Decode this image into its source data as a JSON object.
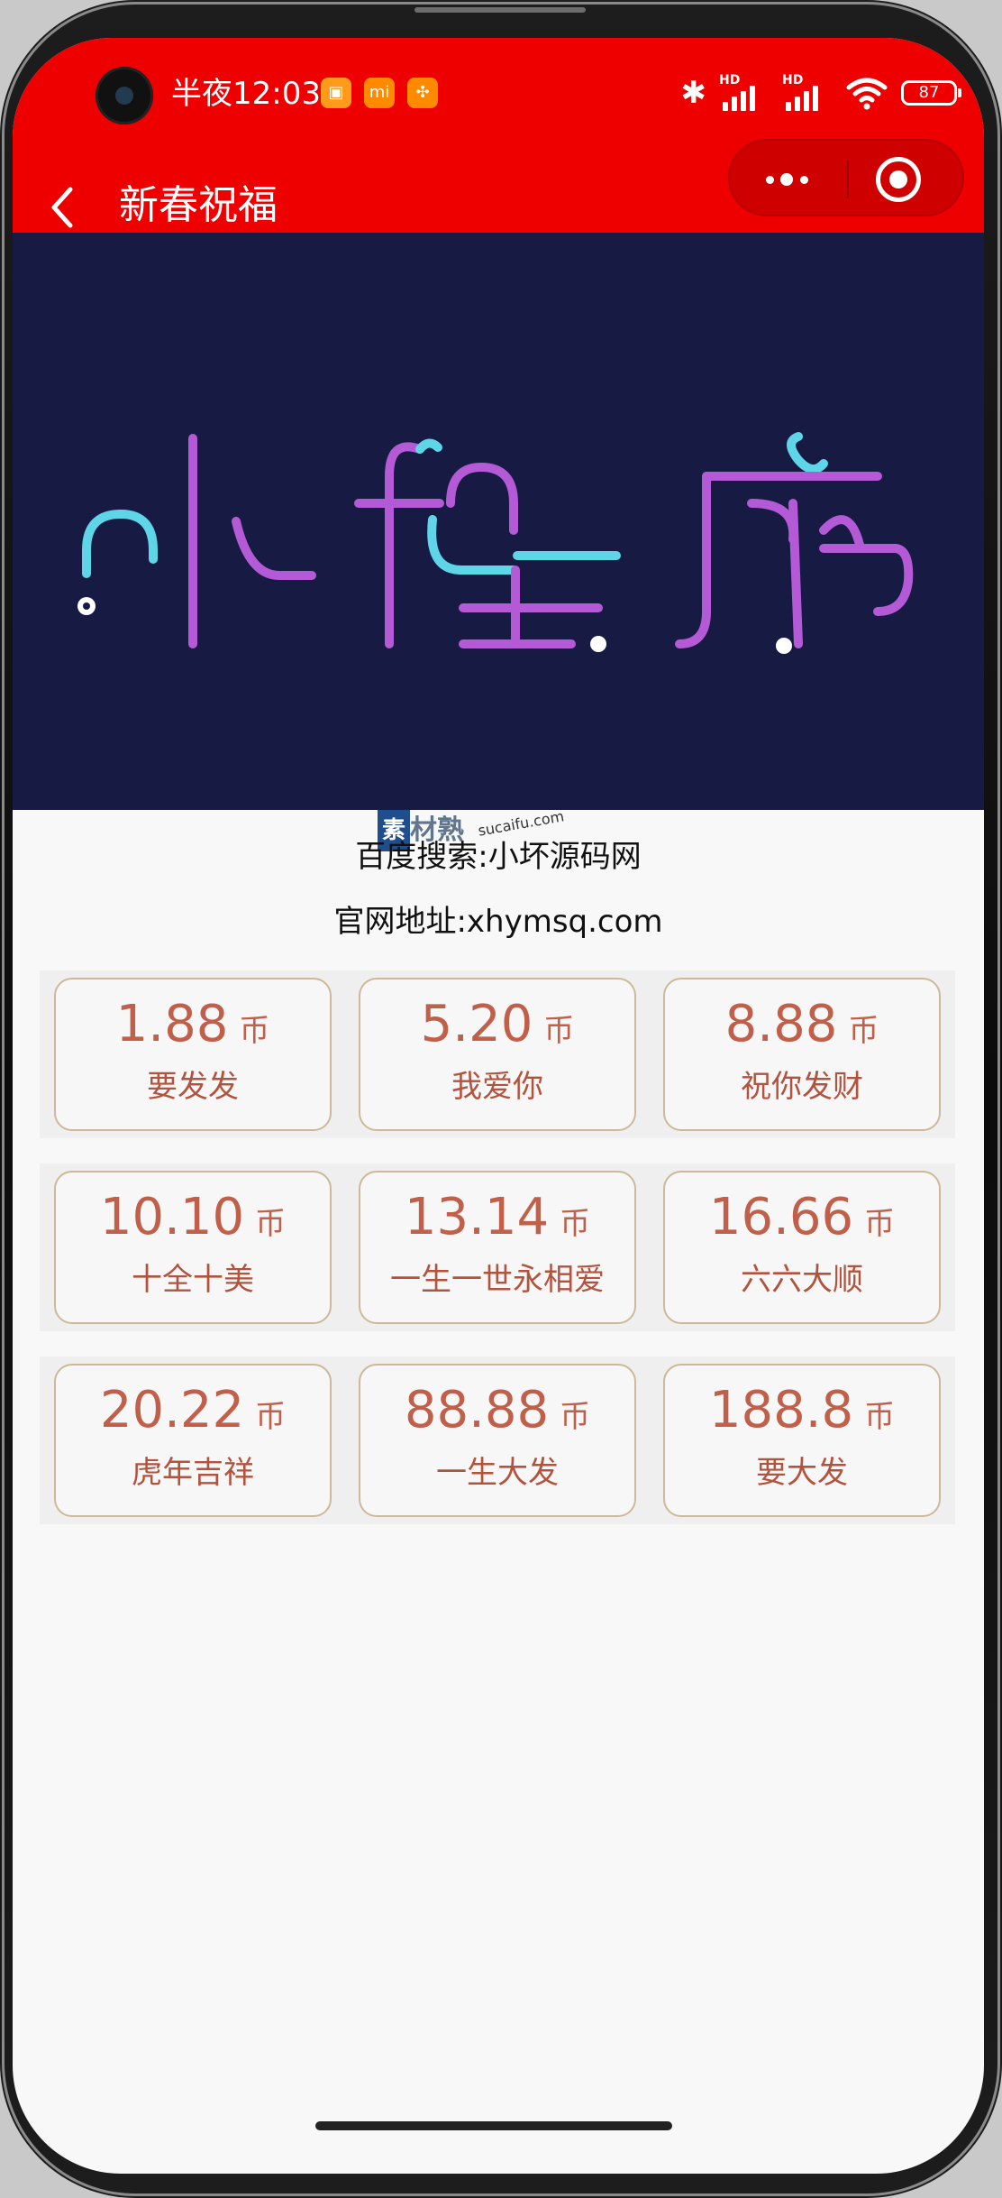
{
  "status_bar": {
    "time": "半夜12:03",
    "battery": "87",
    "hd_label": "HD",
    "notification_icons": [
      "gallery-icon",
      "mi-icon",
      "grid-app-icon"
    ],
    "right_icons": [
      "bluetooth-icon",
      "signal-hd-icon",
      "signal-hd-icon",
      "wifi-icon",
      "battery-icon"
    ]
  },
  "nav": {
    "title": "新春祝福",
    "back_icon": "chevron-left-icon",
    "menu_icon": "more-dots-icon",
    "close_icon": "target-close-icon"
  },
  "banner": {
    "text": "小程序",
    "background": "#171b44",
    "colors": [
      "#5fd6e8",
      "#b45ad6",
      "#ffffff"
    ]
  },
  "watermark": {
    "badge": "素",
    "text": "材熟",
    "url": "sucaifu.com"
  },
  "info": {
    "search_line": "百度搜索:小坏源码网",
    "site_line": "官网地址:xhymsq.com"
  },
  "unit": "币",
  "options": [
    {
      "amount": "1.88",
      "label": "要发发"
    },
    {
      "amount": "5.20",
      "label": "我爱你"
    },
    {
      "amount": "8.88",
      "label": "祝你发财"
    },
    {
      "amount": "10.10",
      "label": "十全十美"
    },
    {
      "amount": "13.14",
      "label": "一生一世永相爱"
    },
    {
      "amount": "16.66",
      "label": "六六大顺"
    },
    {
      "amount": "20.22",
      "label": "虎年吉祥"
    },
    {
      "amount": "88.88",
      "label": "一生大发"
    },
    {
      "amount": "188.8",
      "label": "要大发"
    }
  ],
  "colors": {
    "header_red": "#ee0000",
    "amount_text": "#c0604a",
    "card_border": "#cdb99a"
  }
}
